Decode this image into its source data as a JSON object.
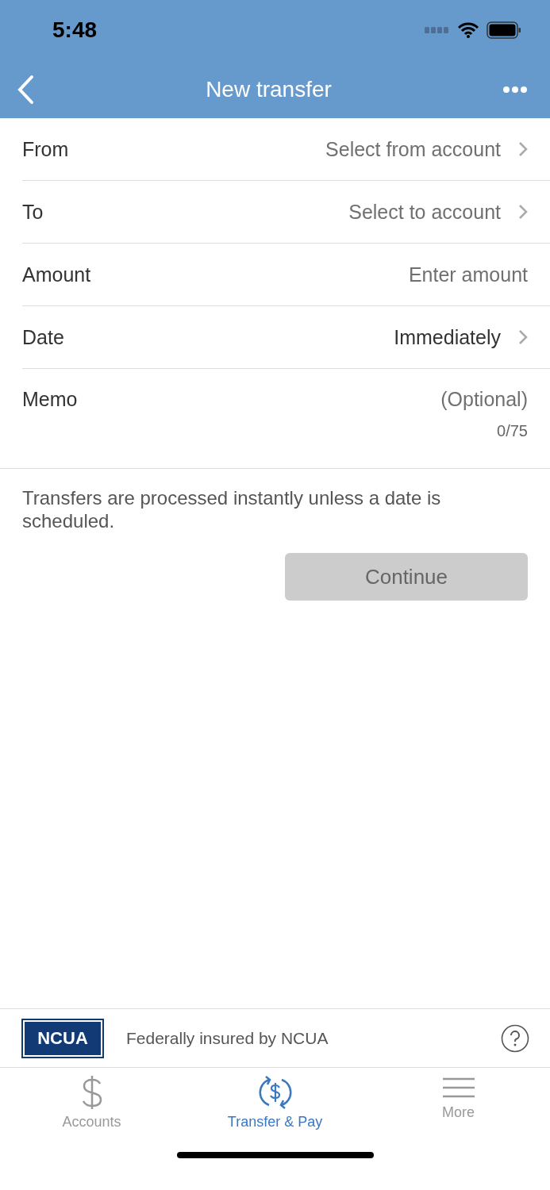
{
  "status_bar": {
    "time": "5:48"
  },
  "nav_bar": {
    "title": "New transfer"
  },
  "fields": [
    {
      "kind": "select",
      "label": "From",
      "placeholder": "Select from account"
    },
    {
      "kind": "select",
      "label": "To",
      "placeholder": "Select to account"
    },
    {
      "kind": "input",
      "label": "Amount",
      "placeholder": "Enter amount"
    },
    {
      "kind": "select",
      "label": "Date",
      "value": "Immediately"
    },
    {
      "kind": "memo",
      "label": "Memo",
      "placeholder": "(Optional)",
      "counter": "0/75"
    }
  ],
  "note": "Transfers are processed instantly unless a date is scheduled.",
  "continue_button": {
    "label": "Continue",
    "disabled": true
  },
  "insurance": {
    "logo": "NCUA",
    "text": "Federally insured by NCUA"
  },
  "tab_bar": [
    {
      "kind": "accounts",
      "label": "Accounts",
      "selected": false
    },
    {
      "kind": "transfer",
      "label": "Transfer & Pay",
      "selected": true
    },
    {
      "kind": "more",
      "label": "More",
      "selected": false
    }
  ]
}
